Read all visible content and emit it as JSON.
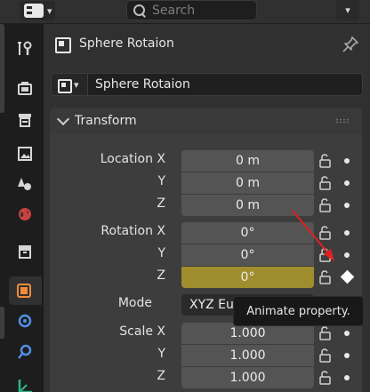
{
  "header": {
    "editor_type_icon": "properties-editor-icon",
    "search_placeholder": "Search"
  },
  "tabs": [
    {
      "name": "tab-tool",
      "icon": "wrench-screwdriver-icon"
    },
    {
      "name": "tab-render",
      "icon": "camera-back-icon"
    },
    {
      "name": "tab-output",
      "icon": "printer-icon"
    },
    {
      "name": "tab-view-layer",
      "icon": "image-icon"
    },
    {
      "name": "tab-scene",
      "icon": "scene-cone-sphere-icon"
    },
    {
      "name": "tab-world",
      "icon": "world-globe-icon"
    },
    {
      "name": "tab-collection",
      "icon": "collection-box-icon"
    },
    {
      "name": "tab-object",
      "icon": "object-square-icon",
      "active": true
    },
    {
      "name": "tab-modifiers",
      "icon": "modifier-icon"
    },
    {
      "name": "tab-physics",
      "icon": "physics-icon"
    },
    {
      "name": "tab-constraints",
      "icon": "constraint-icon"
    }
  ],
  "object": {
    "title": "Sphere Rotaion",
    "name_value": "Sphere Rotaion"
  },
  "transform": {
    "title": "Transform",
    "location": {
      "label_x": "Location X",
      "label_y": "Y",
      "label_z": "Z",
      "x": "0 m",
      "y": "0 m",
      "z": "0 m"
    },
    "rotation": {
      "label_x": "Rotation X",
      "label_y": "Y",
      "label_z": "Z",
      "x": "0°",
      "y": "0°",
      "z": "0°"
    },
    "mode": {
      "label": "Mode",
      "value": "XYZ Eule"
    },
    "scale": {
      "label_x": "Scale X",
      "label_y": "Y",
      "label_z": "Z",
      "x": "1.000",
      "y": "1.000",
      "z": "1.000"
    }
  },
  "tooltip": {
    "text": "Animate property."
  },
  "colors": {
    "keyed_field": "#9f8d2e",
    "annotation_arrow": "#e02020",
    "object_tab_icon": "#f08c3c"
  }
}
